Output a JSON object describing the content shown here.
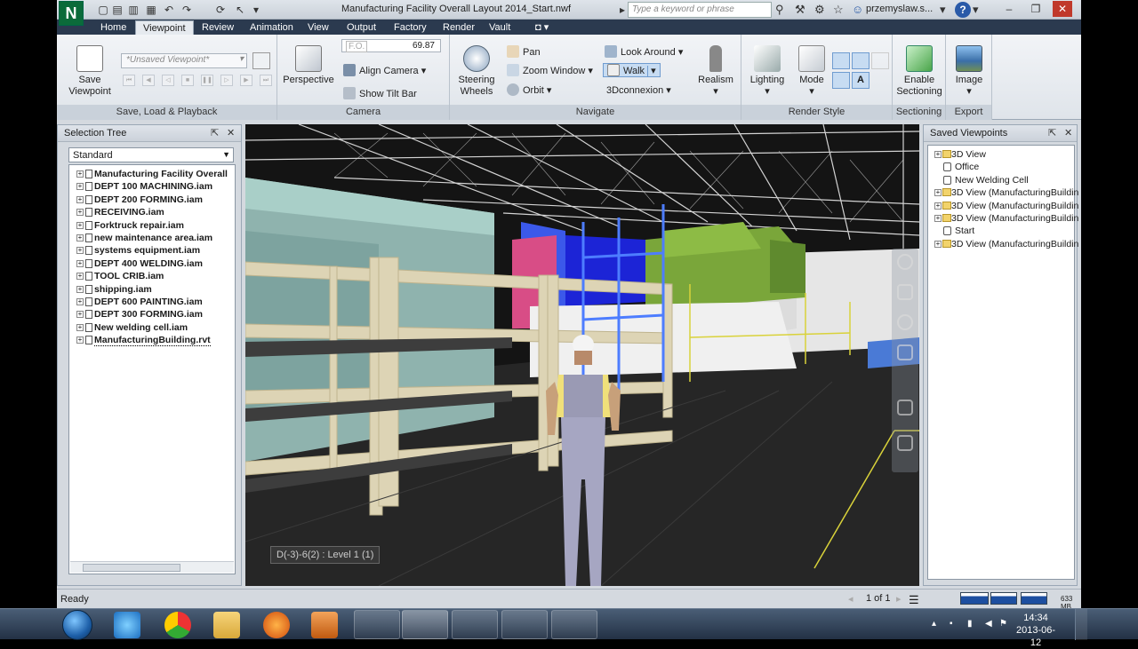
{
  "title_bar": {
    "document_title": "Manufacturing Facility Overall Layout 2014_Start.nwf",
    "search_placeholder": "Type a keyword or phrase",
    "user": "przemyslaw.s..."
  },
  "tabs": [
    "Home",
    "Viewpoint",
    "Review",
    "Animation",
    "View",
    "Output",
    "Factory",
    "Render",
    "Vault"
  ],
  "active_tab": "Viewpoint",
  "ribbon": {
    "save_load": {
      "save_viewpoint": "Save\nViewpoint",
      "viewpoint_select": "*Unsaved Viewpoint*",
      "panel_label": "Save, Load & Playback"
    },
    "camera": {
      "perspective": "Perspective",
      "fov_label": "F.O.",
      "fov_value": "69.87",
      "align_camera": "Align Camera",
      "show_tilt_bar": "Show Tilt Bar",
      "panel_label": "Camera"
    },
    "navigate": {
      "steering_wheels": "Steering\nWheels",
      "pan": "Pan",
      "zoom_window": "Zoom Window",
      "orbit": "Orbit",
      "look_around": "Look Around",
      "walk": "Walk",
      "connexion": "3Dconnexion",
      "realism": "Realism",
      "panel_label": "Navigate"
    },
    "render_style": {
      "lighting": "Lighting",
      "mode": "Mode",
      "panel_label": "Render Style"
    },
    "sectioning": {
      "enable_sectioning": "Enable\nSectioning",
      "panel_label": "Sectioning"
    },
    "export": {
      "image": "Image",
      "panel_label": "Export"
    }
  },
  "selection_tree": {
    "title": "Selection Tree",
    "mode": "Standard",
    "items": [
      "Manufacturing Facility Overall",
      "DEPT 100 MACHINING.iam",
      "DEPT 200 FORMING.iam",
      "RECEIVING.iam",
      "Forktruck repair.iam",
      "new maintenance area.iam",
      "systems equipment.iam",
      "DEPT 400 WELDING.iam",
      "TOOL CRIB.iam",
      "shipping.iam",
      "DEPT 600 PAINTING.iam",
      "DEPT 300 FORMING.iam",
      "New welding cell.iam",
      "ManufacturingBuilding.rvt"
    ]
  },
  "viewport": {
    "level_label": "D(-3)-6(2) : Level 1 (1)"
  },
  "saved_viewpoints": {
    "title": "Saved Viewpoints",
    "items": [
      {
        "label": "3D View",
        "kind": "folder"
      },
      {
        "label": "Office",
        "kind": "view"
      },
      {
        "label": "New Welding Cell",
        "kind": "view"
      },
      {
        "label": "3D View (ManufacturingBuildin",
        "kind": "folder"
      },
      {
        "label": "3D View (ManufacturingBuildin",
        "kind": "folder"
      },
      {
        "label": "3D View (ManufacturingBuildin",
        "kind": "folder"
      },
      {
        "label": "Start",
        "kind": "view"
      },
      {
        "label": "3D View (ManufacturingBuildin",
        "kind": "folder"
      }
    ]
  },
  "status_bar": {
    "status": "Ready",
    "page": "1 of 1",
    "memory": "633 MB"
  },
  "taskbar": {
    "time": "14:34",
    "date": "2013-06-12"
  }
}
